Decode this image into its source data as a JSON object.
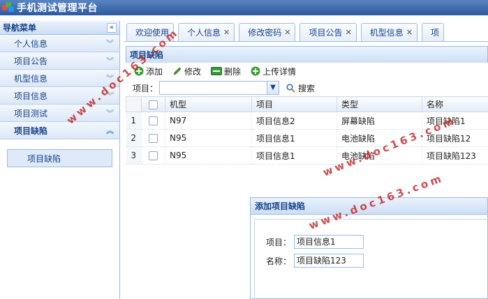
{
  "header": {
    "title": "手机测试管理平台"
  },
  "sidebar": {
    "title": "导航菜单",
    "items": [
      {
        "label": "个人信息"
      },
      {
        "label": "项目公告"
      },
      {
        "label": "机型信息"
      },
      {
        "label": "项目信息"
      },
      {
        "label": "项目测试"
      },
      {
        "label": "项目缺陷"
      }
    ],
    "sub_items": [
      {
        "label": "项目缺陷"
      }
    ]
  },
  "tabs": [
    {
      "label": "欢迎使用"
    },
    {
      "label": "个人信息"
    },
    {
      "label": "修改密码"
    },
    {
      "label": "项目公告"
    },
    {
      "label": "机型信息"
    },
    {
      "label": "项"
    }
  ],
  "panel": {
    "title": "项目缺陷"
  },
  "toolbar": {
    "add": "添加",
    "edit": "修改",
    "delete": "删除",
    "upload": "上传详情"
  },
  "search": {
    "label": "项目：",
    "value": "",
    "button": "搜索"
  },
  "grid": {
    "columns": [
      "机型",
      "项目",
      "类型",
      "名称"
    ],
    "rows": [
      {
        "num": "1",
        "model": "N97",
        "project": "项目信息2",
        "type": "屏幕缺陷",
        "name": "项目缺陷1"
      },
      {
        "num": "2",
        "model": "N95",
        "project": "项目信息1",
        "type": "电池缺陷",
        "name": "项目缺陷12"
      },
      {
        "num": "3",
        "model": "N95",
        "project": "项目信息1",
        "type": "电池缺陷",
        "name": "项目缺陷123"
      }
    ]
  },
  "dialog": {
    "title": "添加项目缺陷",
    "project_label": "项目：",
    "project_value": "项目信息1",
    "name_label": "名称：",
    "name_value": "项目缺陷123"
  },
  "watermark": {
    "text": "www.doc163.com"
  },
  "colors": {
    "header": "#2c5aa0",
    "accent": "#15428b",
    "border": "#99bbe8",
    "watermark": "#c42020"
  }
}
